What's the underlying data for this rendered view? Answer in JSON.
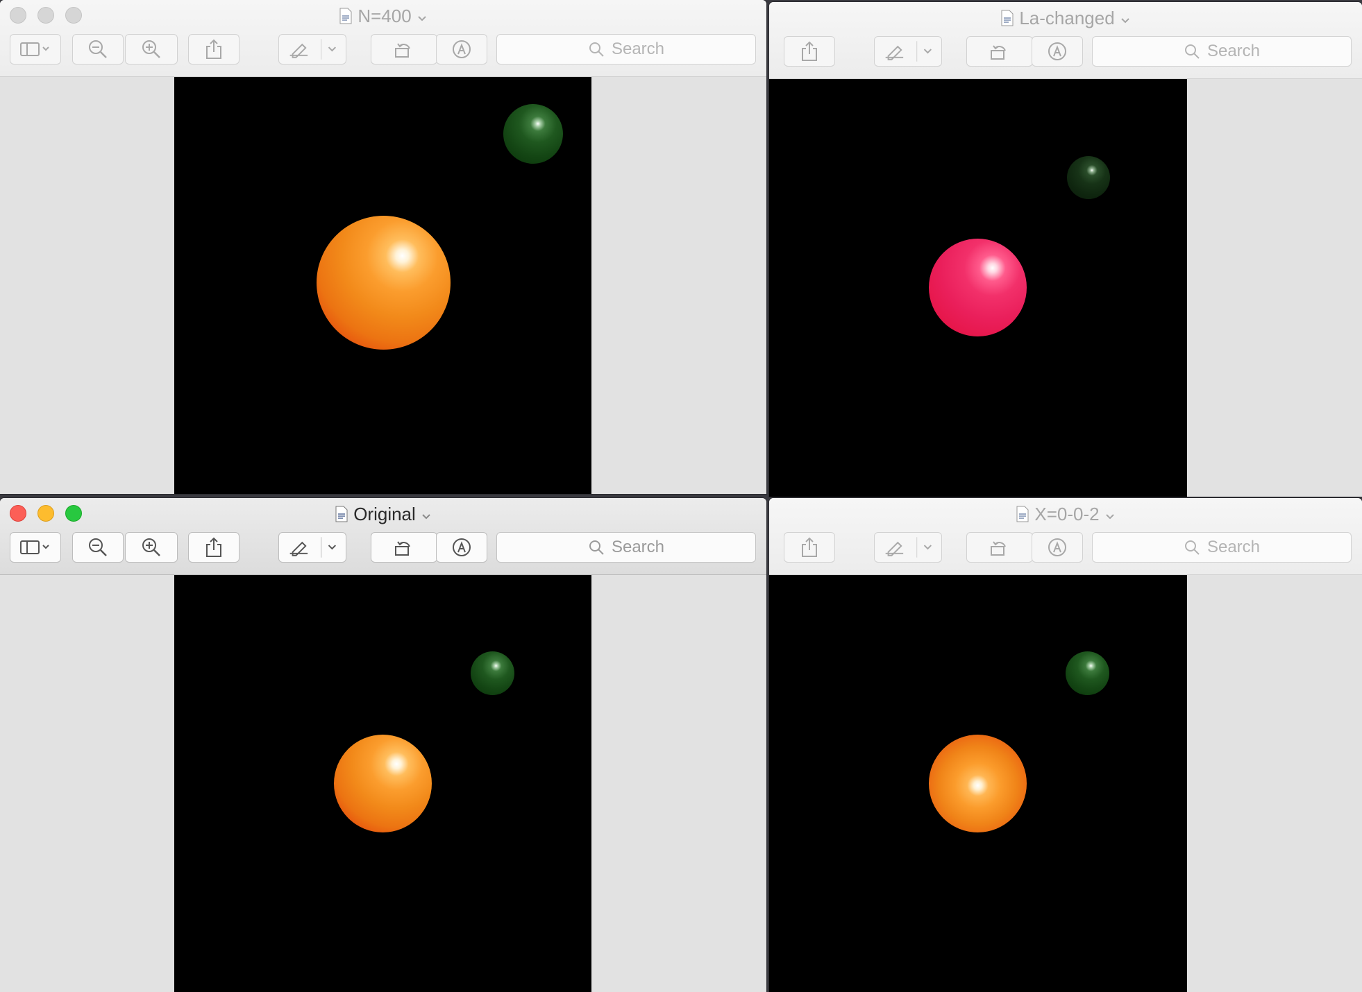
{
  "windows": [
    {
      "id": "n400",
      "title": "N=400",
      "active": false,
      "search_placeholder": "Search",
      "scene": {
        "primary_sphere_color": "orange",
        "secondary_sphere_color": "dark green"
      }
    },
    {
      "id": "la-changed",
      "title": "La-changed",
      "active": false,
      "search_placeholder": "Search",
      "scene": {
        "primary_sphere_color": "pink",
        "secondary_sphere_color": "dark green"
      }
    },
    {
      "id": "original",
      "title": "Original",
      "active": true,
      "search_placeholder": "Search",
      "scene": {
        "primary_sphere_color": "orange",
        "secondary_sphere_color": "dark green"
      }
    },
    {
      "id": "x002",
      "title": "X=0-0-2",
      "active": false,
      "search_placeholder": "Search",
      "scene": {
        "primary_sphere_color": "orange",
        "secondary_sphere_color": "dark green"
      }
    }
  ],
  "toolbar": {
    "icons": [
      "sidebar-icon",
      "zoom-out-icon",
      "zoom-in-icon",
      "share-icon",
      "markup-pen-icon",
      "rotate-icon",
      "annotate-icon",
      "search-icon"
    ]
  },
  "colors": {
    "background": "#e2e2e2",
    "canvas": "#000000",
    "close": "#fc5f57",
    "minimize": "#fdbc2e",
    "zoom": "#28c840"
  }
}
